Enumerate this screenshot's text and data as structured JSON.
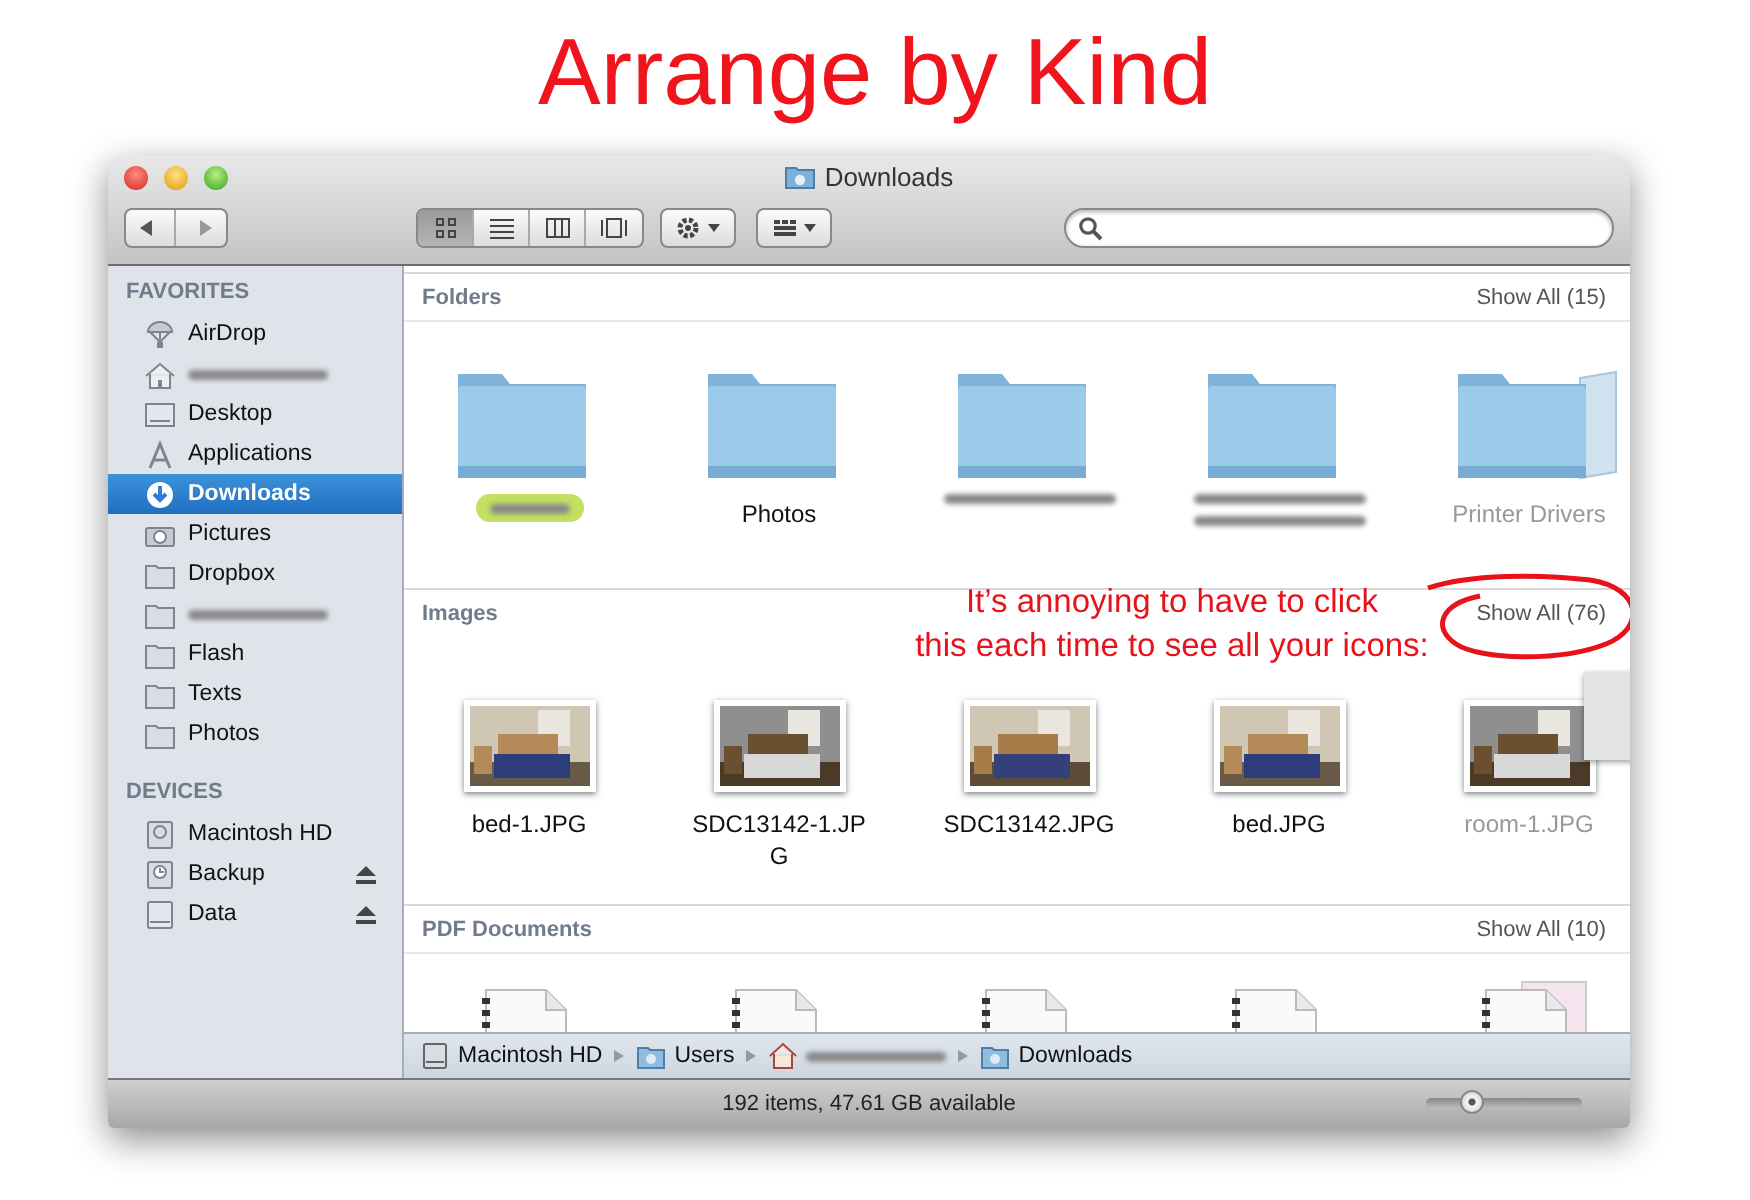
{
  "heading": "Arrange by Kind",
  "window": {
    "title": "Downloads"
  },
  "toolbar": {
    "views": [
      {
        "kind": "icons",
        "selected": true
      },
      {
        "kind": "list",
        "selected": false
      },
      {
        "kind": "columns",
        "selected": false
      },
      {
        "kind": "coverflow",
        "selected": false
      }
    ]
  },
  "sidebar": [
    {
      "title": "FAVORITES",
      "items": [
        {
          "label": "AirDrop",
          "selected": false
        },
        {
          "redacted": true,
          "selected": false
        },
        {
          "label": "Desktop",
          "selected": false
        },
        {
          "label": "Applications",
          "selected": false
        },
        {
          "label": "Downloads",
          "selected": true
        },
        {
          "label": "Pictures",
          "selected": false
        },
        {
          "label": "Dropbox",
          "selected": false
        },
        {
          "redacted": true,
          "selected": false
        },
        {
          "label": "Flash",
          "selected": false
        },
        {
          "label": "Texts",
          "selected": false
        },
        {
          "label": "Photos",
          "selected": false
        }
      ]
    },
    {
      "title": "DEVICES",
      "items": [
        {
          "label": "Macintosh HD",
          "selected": false,
          "eject": false
        },
        {
          "label": "Backup",
          "selected": false,
          "eject": true
        },
        {
          "label": "Data",
          "selected": false,
          "eject": true
        }
      ]
    }
  ],
  "sections": [
    {
      "title": "Folders",
      "show_all": "Show All (15)",
      "items": [
        {
          "kind": "folder",
          "redacted": true,
          "color": "#c4e060"
        },
        {
          "kind": "folder",
          "name": "Photos"
        },
        {
          "kind": "folder",
          "redacted": true
        },
        {
          "kind": "folder",
          "redacted": true,
          "wrapped": true
        },
        {
          "kind": "folder",
          "name": "Printer Drivers",
          "stack": true
        }
      ]
    },
    {
      "title": "Images",
      "show_all": "Show All (76)",
      "items": [
        {
          "name": "bed-1.JPG"
        },
        {
          "name": "SDC13142-1.JP G"
        },
        {
          "name": "SDC13142.JPG"
        },
        {
          "name": "bed.JPG"
        },
        {
          "name": "room-1.JPG",
          "stack": true
        }
      ]
    },
    {
      "title": "PDF Documents",
      "show_all": "Show All (10)",
      "items": [
        {
          "kind": "document"
        },
        {
          "kind": "document"
        },
        {
          "kind": "document"
        },
        {
          "kind": "document"
        },
        {
          "kind": "document",
          "stack": true
        }
      ]
    }
  ],
  "path": [
    {
      "label": "Macintosh HD"
    },
    {
      "label": "Users"
    },
    {
      "redacted": true
    },
    {
      "label": "Downloads"
    }
  ],
  "status": {
    "text": "192 items, 47.61 GB available",
    "zoom": {
      "level": 0.3
    }
  },
  "annotation": {
    "lines": [
      "It’s annoying to have to click",
      "this each time to see all your icons:"
    ]
  }
}
